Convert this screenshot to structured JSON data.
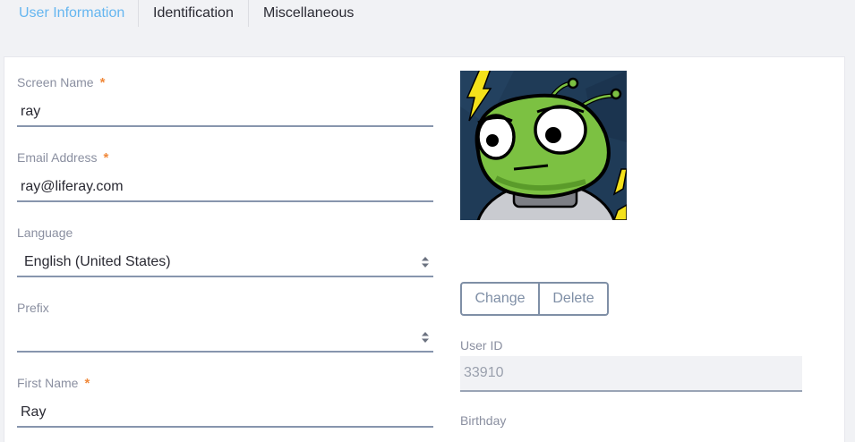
{
  "tabs": [
    {
      "label": "User Information",
      "active": true
    },
    {
      "label": "Identification",
      "active": false
    },
    {
      "label": "Miscellaneous",
      "active": false
    }
  ],
  "form": {
    "required_marker": "*",
    "screen_name": {
      "label": "Screen Name",
      "value": "ray",
      "required": true
    },
    "email": {
      "label": "Email Address",
      "value": "ray@liferay.com",
      "required": true
    },
    "language": {
      "label": "Language",
      "value": "English (United States)"
    },
    "prefix": {
      "label": "Prefix",
      "value": ""
    },
    "first_name": {
      "label": "First Name",
      "value": "Ray",
      "required": true
    }
  },
  "portrait": {
    "icon": "alien-avatar",
    "change_label": "Change",
    "delete_label": "Delete"
  },
  "user_id": {
    "label": "User ID",
    "value": "33910"
  },
  "birthday": {
    "label": "Birthday"
  },
  "colors": {
    "active_tab": "#65b6f0",
    "required": "#f0893b",
    "field_border": "#8795ad",
    "background": "#f1f2f5"
  }
}
